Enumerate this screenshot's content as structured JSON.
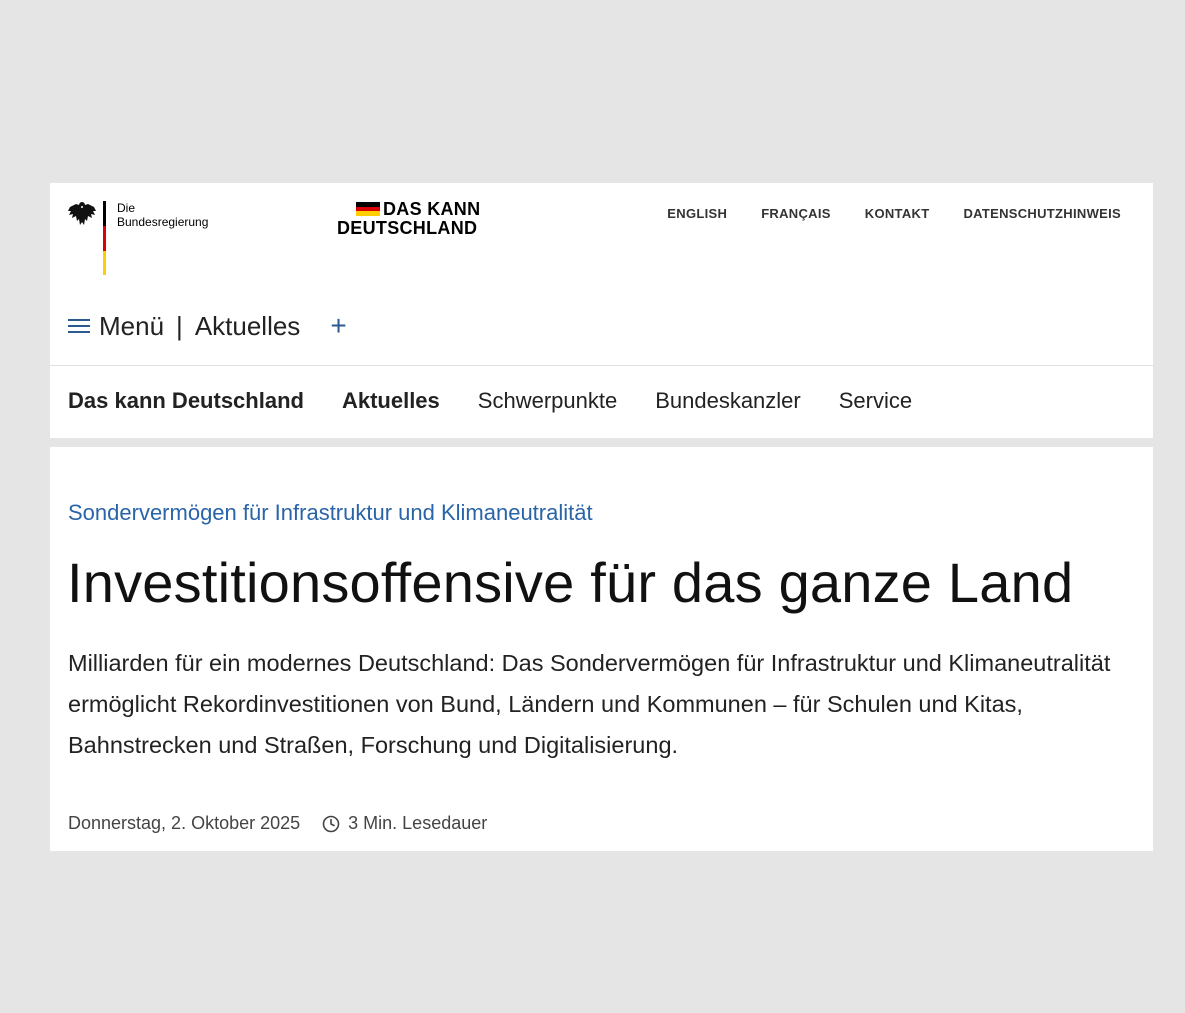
{
  "header": {
    "bund_logo_lines": [
      "Die",
      "Bundesregierung"
    ],
    "campaign_logo_lines": [
      "DAS KANN",
      "DEUTSCHLAND"
    ],
    "meta_nav": [
      "ENGLISH",
      "FRANÇAIS",
      "KONTAKT",
      "DATENSCHUTZHINWEIS"
    ],
    "menu_label": "Menü",
    "menu_separator": "|",
    "menu_current": "Aktuelles",
    "plus_symbol": "+",
    "main_nav": [
      {
        "label": "Das kann Deutschland"
      },
      {
        "label": "Aktuelles"
      },
      {
        "label": "Schwerpunkte"
      },
      {
        "label": "Bundeskanzler"
      },
      {
        "label": "Service"
      }
    ]
  },
  "article": {
    "kicker": "Sondervermögen für Infrastruktur und Klimaneutralität",
    "title": "Investitionsoffensive für das ganze Land",
    "lead": "Milliarden für ein modernes Deutschland: Das Sondervermögen für Infrastruktur und Klimaneutralität ermöglicht Rekordinvestitionen von Bund, Ländern und Kommunen – für Schulen und Kitas, Bahnstrecken und Straßen, Forschung und Digitalisierung.",
    "date": "Donnerstag, 2. Oktober 2025",
    "read_time": "3 Min. Lesedauer"
  },
  "colors": {
    "accent_blue": "#2b5a90",
    "kicker_blue": "#2a64a8",
    "flag_black": "#000000",
    "flag_red": "#dd0000",
    "flag_gold": "#ffce00"
  },
  "icons": [
    "federal-eagle-icon",
    "german-flag-icon",
    "hamburger-icon",
    "plus-icon",
    "clock-icon"
  ]
}
